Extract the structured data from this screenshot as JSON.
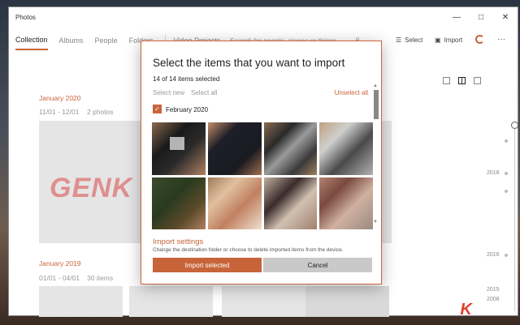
{
  "window": {
    "title": "Photos",
    "controls": {
      "minimize": "—",
      "maximize": "□",
      "close": "✕"
    }
  },
  "nav": {
    "tabs": [
      "Collection",
      "Albums",
      "People",
      "Folders",
      "Video Projects"
    ],
    "active": "Collection",
    "search_placeholder": "Search for people, places or things...",
    "select_label": "Select",
    "import_label": "Import",
    "more_label": "···"
  },
  "collection": {
    "groups": [
      {
        "month": "January 2020",
        "range": "11/01 - 12/01",
        "count": "2 photos"
      },
      {
        "month": "January 2019",
        "range": "01/01 - 04/01",
        "count": "30 items"
      }
    ],
    "watermark": "GENK"
  },
  "timeline": {
    "labels": [
      "2018",
      "2016",
      "2015",
      "2008"
    ]
  },
  "dialog": {
    "title": "Select the items that you want to import",
    "count_text": "14 of 14 items selected",
    "select_new": "Select new",
    "select_all": "Select all",
    "unselect_all": "Unselect all",
    "group_label": "February 2020",
    "group_checked": true,
    "settings_title": "Import settings",
    "settings_desc": "Change the destination folder or choose to delete imported items from the device.",
    "import_button": "Import selected",
    "cancel_button": "Cancel"
  },
  "colors": {
    "accent": "#c8643a",
    "watermark_k": "#e0402e"
  },
  "logo": {
    "prefix": "GEN",
    "suffix": "K"
  }
}
